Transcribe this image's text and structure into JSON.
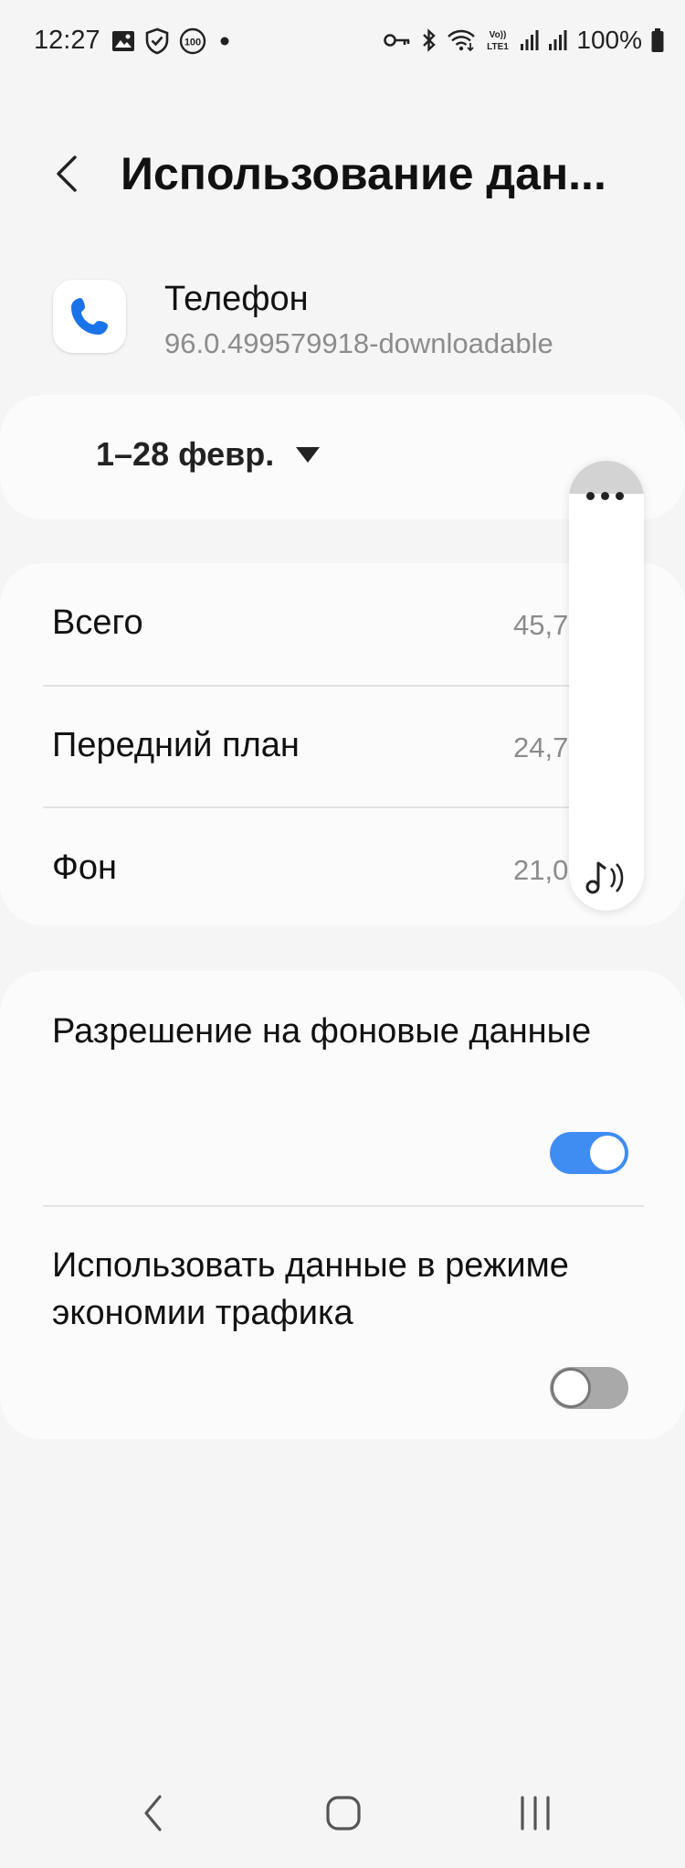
{
  "status_bar": {
    "time": "12:27",
    "battery": "100%",
    "left_icons": [
      "image-icon",
      "shield-check-icon",
      "badge-100-icon",
      "dot-icon"
    ],
    "badge_text": "100",
    "right_icons": [
      "key-icon",
      "bluetooth-icon",
      "wifi-icon",
      "volte-icon",
      "signal-icon",
      "signal-icon",
      "battery-icon"
    ],
    "volte_text": [
      "Vo))",
      "LTE1"
    ]
  },
  "header": {
    "title": "Использование дан..."
  },
  "app": {
    "name": "Телефон",
    "version": "96.0.499579918-downloadable",
    "icon": "phone-icon",
    "accent": "#1a73e8"
  },
  "period": {
    "label": "1–28 февр."
  },
  "usage": {
    "rows": [
      {
        "label": "Всего",
        "value": "45,7"
      },
      {
        "label": "Передний план",
        "value": "24,7"
      },
      {
        "label": "Фон",
        "value": "21,0"
      }
    ]
  },
  "settings": {
    "background_data": {
      "label": "Разрешение на фоновые данные",
      "enabled": true
    },
    "data_saver": {
      "label": "Использовать данные в режиме экономии трафика",
      "enabled": false
    },
    "toggle_on_color": "#3f8cf2"
  },
  "edge_panel": {
    "icons": [
      "more-icon",
      "media-output-icon"
    ]
  },
  "nav_bar": {
    "icons": [
      "nav-back-icon",
      "nav-home-icon",
      "nav-recents-icon"
    ]
  }
}
